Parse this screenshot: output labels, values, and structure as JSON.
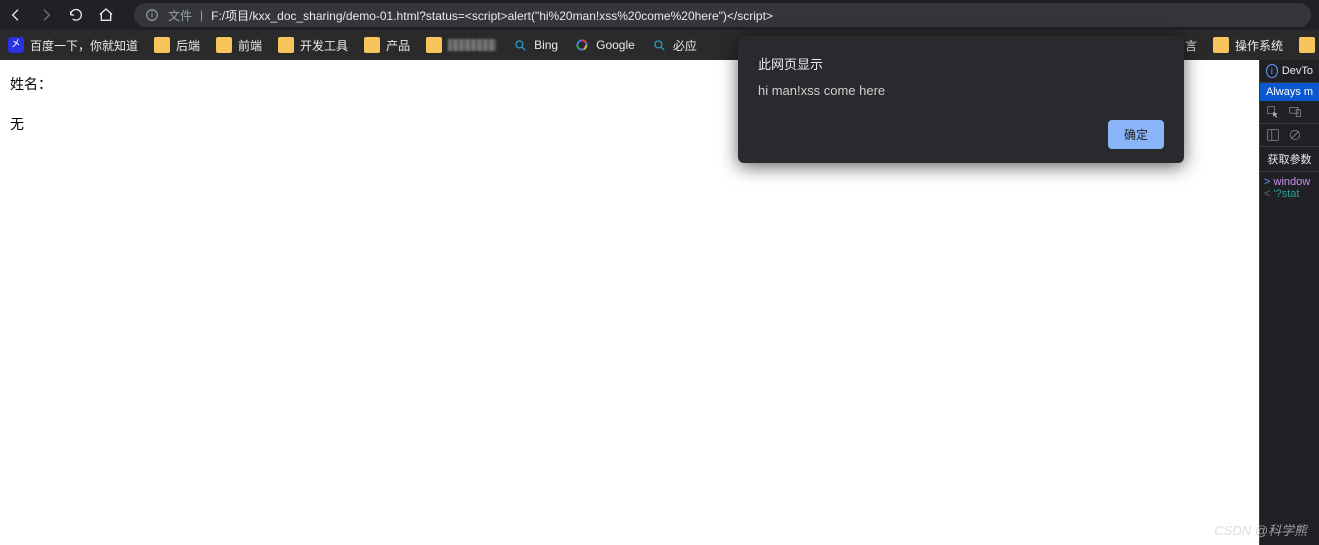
{
  "addressbar": {
    "file_label": "文件",
    "url": "F:/项目/kxx_doc_sharing/demo-01.html?status=<script>alert(\"hi%20man!xss%20come%20here\")</script>"
  },
  "bookmarks": {
    "items": [
      {
        "label": "百度一下，你就知道",
        "icon": "baidu"
      },
      {
        "label": "后端",
        "icon": "folder"
      },
      {
        "label": "前端",
        "icon": "folder"
      },
      {
        "label": "开发工具",
        "icon": "folder"
      },
      {
        "label": "产品",
        "icon": "folder"
      },
      {
        "label": "",
        "icon": "folder-pixels"
      },
      {
        "label": "Bing",
        "icon": "bing"
      },
      {
        "label": "Google",
        "icon": "google"
      },
      {
        "label": "必应",
        "icon": "bing"
      }
    ],
    "right_items": [
      {
        "label": "言",
        "icon": "none"
      },
      {
        "label": "操作系统",
        "icon": "folder"
      }
    ]
  },
  "page": {
    "line1": "姓名：",
    "line2": "无"
  },
  "alert": {
    "title": "此网页显示",
    "message": "hi man!xss come here",
    "ok_label": "确定"
  },
  "devtools": {
    "header_label": "DevTo",
    "banner": "Always m",
    "tab": "获取参数",
    "console": {
      "line1_prefix": ">",
      "line1_text": "window",
      "line2_prefix": "<",
      "line2_text": "'?stat"
    }
  },
  "watermark": "CSDN @科学熊"
}
